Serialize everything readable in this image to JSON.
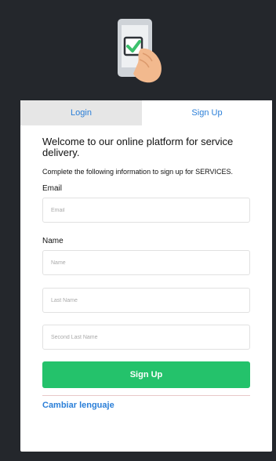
{
  "tabs": {
    "login": "Login",
    "signup": "Sign Up"
  },
  "welcome": "Welcome to our online platform for service delivery.",
  "instructions": "Complete the following information to sign up for SERVICES.",
  "form": {
    "email_label": "Email",
    "email_placeholder": "Email",
    "name_label": "Name",
    "name_placeholder": "Name",
    "last_name_placeholder": "Last Name",
    "second_last_name_placeholder": "Second Last Name"
  },
  "submit_label": "Sign Up",
  "language_link": "Cambiar lenguaje",
  "colors": {
    "background": "#24272c",
    "accent_blue": "#2b7fd8",
    "button_green": "#24c26b",
    "inactive_tab": "#e6e6e6"
  },
  "icons": {
    "hero": "hand-holding-phone-check-icon"
  }
}
